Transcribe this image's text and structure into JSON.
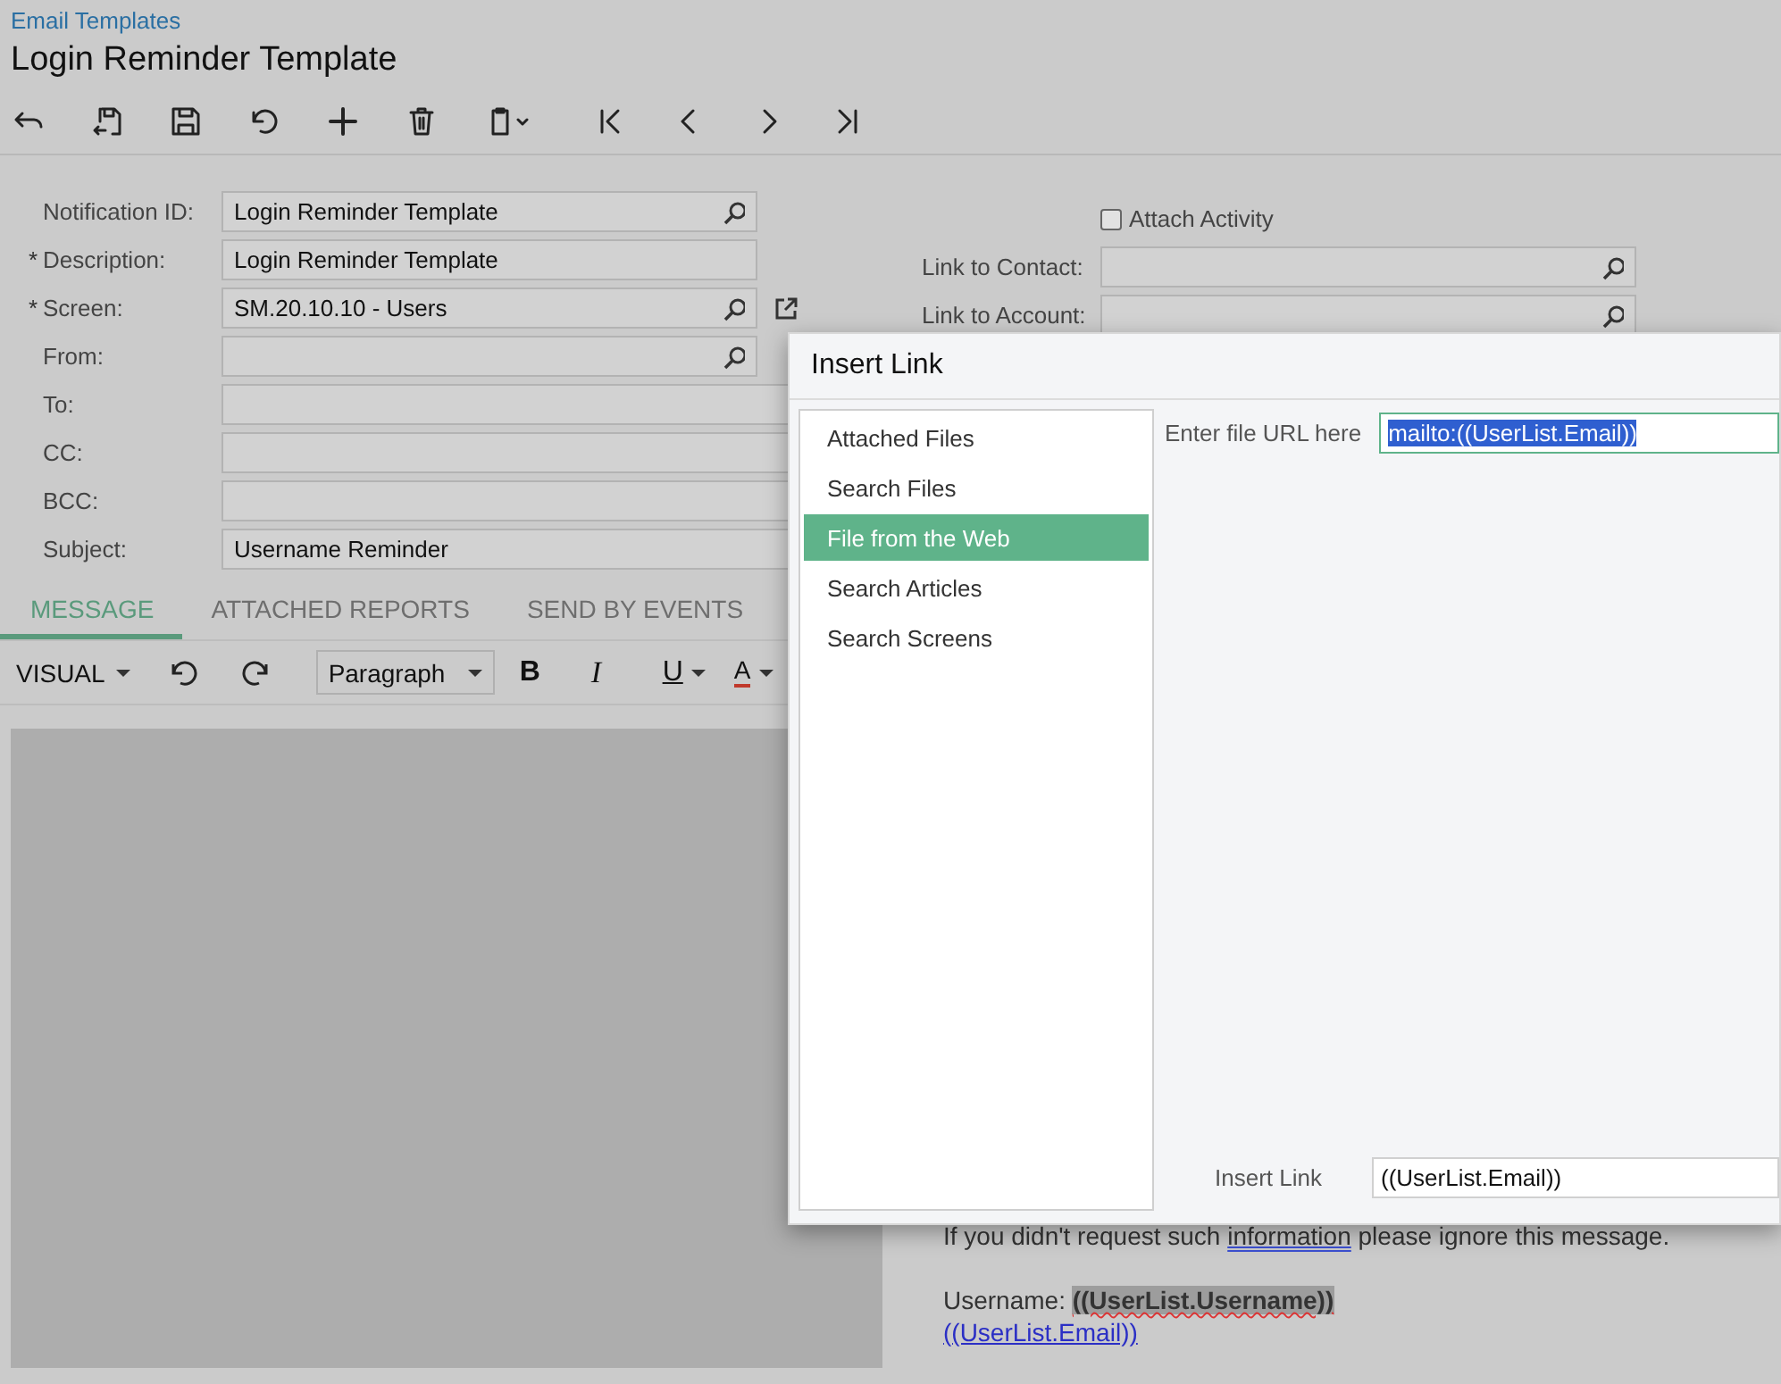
{
  "breadcrumb": "Email Templates",
  "title": "Login Reminder Template",
  "form": {
    "required_mark": "*",
    "left_fields": [
      {
        "label": "Notification ID:",
        "required": false,
        "kind": "lookup",
        "value": "Login Reminder Template"
      },
      {
        "label": "Description:",
        "required": true,
        "kind": "text",
        "value": "Login Reminder Template"
      },
      {
        "label": "Screen:",
        "required": true,
        "kind": "lookup_link",
        "value": "SM.20.10.10 - Users"
      },
      {
        "label": "From:",
        "required": false,
        "kind": "lookup"
      },
      {
        "label": "To:",
        "required": false,
        "kind": "wide"
      },
      {
        "label": "CC:",
        "required": false,
        "kind": "wide"
      },
      {
        "label": "BCC:",
        "required": false,
        "kind": "wide"
      },
      {
        "label": "Subject:",
        "required": false,
        "kind": "wide",
        "value": "Username Reminder"
      }
    ],
    "right_fields": [
      {
        "kind": "checkbox",
        "label": "Attach Activity",
        "checked": false
      },
      {
        "kind": "lookup",
        "label": "Link to Contact:"
      },
      {
        "kind": "lookup",
        "label": "Link to Account:"
      }
    ]
  },
  "tabs": [
    {
      "label": "MESSAGE",
      "selected": true
    },
    {
      "label": "ATTACHED REPORTS",
      "selected": false
    },
    {
      "label": "SEND BY EVENTS",
      "selected": false
    }
  ],
  "editor_toolbar": [
    {
      "kind": "dropdown",
      "label": "VISUAL"
    },
    {
      "kind": "undo"
    },
    {
      "kind": "redo"
    },
    {
      "kind": "select",
      "label": "Paragraph"
    },
    {
      "kind": "bold",
      "label": "B"
    },
    {
      "kind": "italic",
      "label": "I"
    },
    {
      "kind": "underline",
      "label": "U"
    },
    {
      "kind": "font_color",
      "label": "A"
    }
  ],
  "body": [
    {
      "kind": "text",
      "parts": [
        {
          "text": "If you didn't request such "
        },
        {
          "text": "information",
          "underlined": true
        },
        {
          "text": " please ignore this message."
        }
      ]
    },
    {
      "kind": "blank"
    },
    {
      "kind": "text",
      "parts": [
        {
          "text": "Username: "
        },
        {
          "text": "((UserList.Username))",
          "highlighted": true
        }
      ]
    },
    {
      "kind": "link",
      "parts": [
        {
          "text": "((UserList.Email))"
        }
      ]
    }
  ],
  "dialog": {
    "title": "Insert Link",
    "sources": [
      {
        "label": "Attached Files",
        "selected": false
      },
      {
        "label": "Search Files",
        "selected": false
      },
      {
        "label": "File from the Web",
        "selected": true
      },
      {
        "label": "Search Articles",
        "selected": false
      },
      {
        "label": "Search Screens",
        "selected": false
      }
    ],
    "url_label": "Enter file URL here",
    "url_value": "mailto:((UserList.Email))",
    "link_label": "Insert Link",
    "link_value": "((UserList.Email))"
  }
}
